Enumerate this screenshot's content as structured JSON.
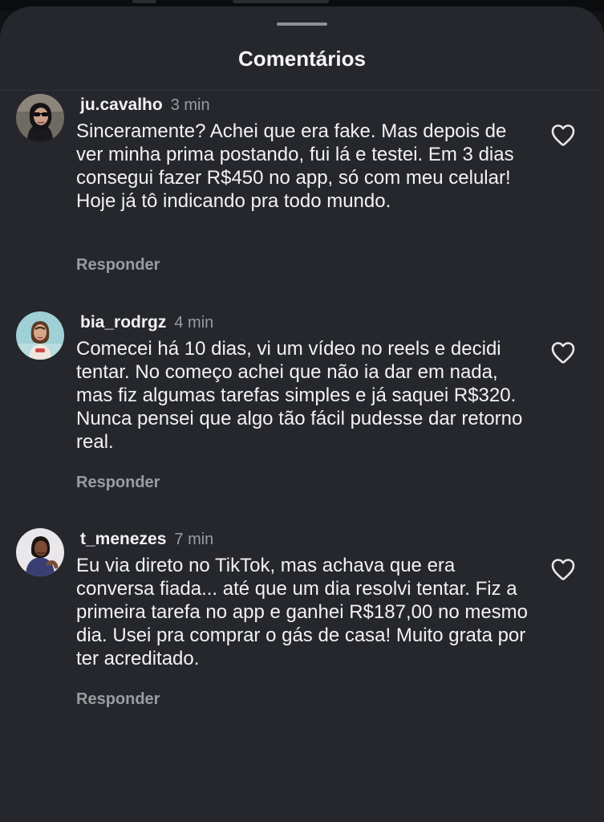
{
  "sheet": {
    "title": "Comentários"
  },
  "comments": [
    {
      "username": "ju.cavalho",
      "time": "3 min",
      "text": "Sinceramente? Achei que era fake. Mas depois de ver minha prima postando, fui lá e testei. Em 3 dias consegui fazer R$450 no app, só com meu celular! Hoje já tô indicando pra todo mundo.",
      "reply_label": "Responder",
      "like_icon": "heart-outline-icon"
    },
    {
      "username": "bia_rodrgz",
      "time": "4 min",
      "text": "Comecei há 10 dias, vi um vídeo no reels e decidi tentar. No começo achei que não ia dar em nada, mas fiz algumas tarefas simples e já saquei R$320. Nunca pensei que algo tão fácil pudesse dar retorno real.",
      "reply_label": "Responder",
      "like_icon": "heart-outline-icon"
    },
    {
      "username": "t_menezes",
      "time": "7 min",
      "text": "Eu via direto no TikTok, mas achava que era conversa fiada... até que um dia resolvi tentar. Fiz a primeira tarefa no app e ganhei R$187,00 no mesmo dia. Usei pra comprar o gás de casa! Muito grata por ter acreditado.",
      "reply_label": "Responder",
      "like_icon": "heart-outline-icon"
    }
  ],
  "colors": {
    "sheet_background": "#25272c",
    "primary_text": "#f2f2f2",
    "secondary_text": "#9a9ca1",
    "grabber": "#8e9096"
  }
}
